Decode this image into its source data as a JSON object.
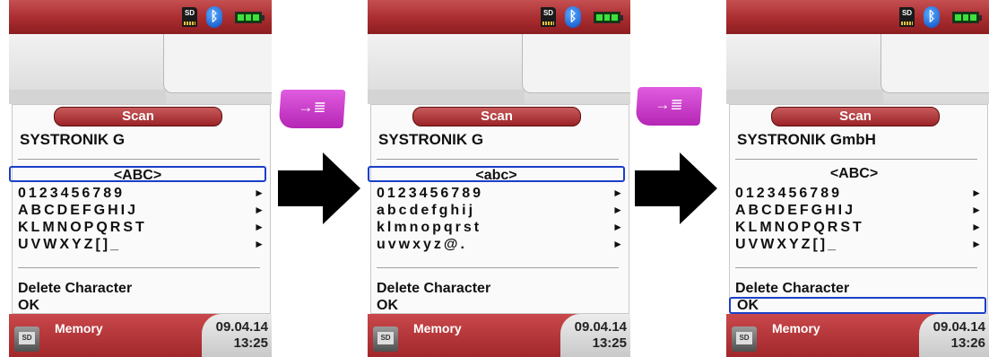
{
  "screens": [
    {
      "tab_title": "Scan",
      "field_value": "SYSTRONIK G",
      "mode": "<ABC>",
      "mode_selected": true,
      "rows": [
        "0123456789",
        "ABCDEFGHIJ",
        "KLMNOPQRST",
        "UVWXYZ[]_"
      ],
      "delete_label": "Delete Character",
      "ok_label": "OK",
      "ok_selected": false,
      "status": {
        "sd": "SD"
      },
      "footer_label": "Memory",
      "date": "09.04.14",
      "time": "13:25"
    },
    {
      "tab_title": "Scan",
      "field_value": "SYSTRONIK G",
      "mode": "<abc>",
      "mode_selected": true,
      "rows": [
        "0123456789",
        "abcdefghij",
        "klmnopqrst",
        "uvwxyz@."
      ],
      "delete_label": "Delete Character",
      "ok_label": "OK",
      "ok_selected": false,
      "status": {
        "sd": "SD"
      },
      "footer_label": "Memory",
      "date": "09.04.14",
      "time": "13:25"
    },
    {
      "tab_title": "Scan",
      "field_value": "SYSTRONIK GmbH",
      "mode": "<ABC>",
      "mode_selected": false,
      "rows": [
        "0123456789",
        "ABCDEFGHIJ",
        "KLMNOPQRST",
        "UVWXYZ[]_"
      ],
      "delete_label": "Delete Character",
      "ok_label": "OK",
      "ok_selected": true,
      "status": {
        "sd": "SD"
      },
      "footer_label": "Memory",
      "date": "09.04.14",
      "time": "13:26"
    }
  ],
  "key_button": {
    "glyph": "→≣",
    "color": "#c83ac8"
  },
  "row_arrow_glyph": "►",
  "colors": {
    "bar_red": "#a92c2f",
    "selection_blue": "#1b3fc9",
    "arrow_black": "#000000"
  }
}
